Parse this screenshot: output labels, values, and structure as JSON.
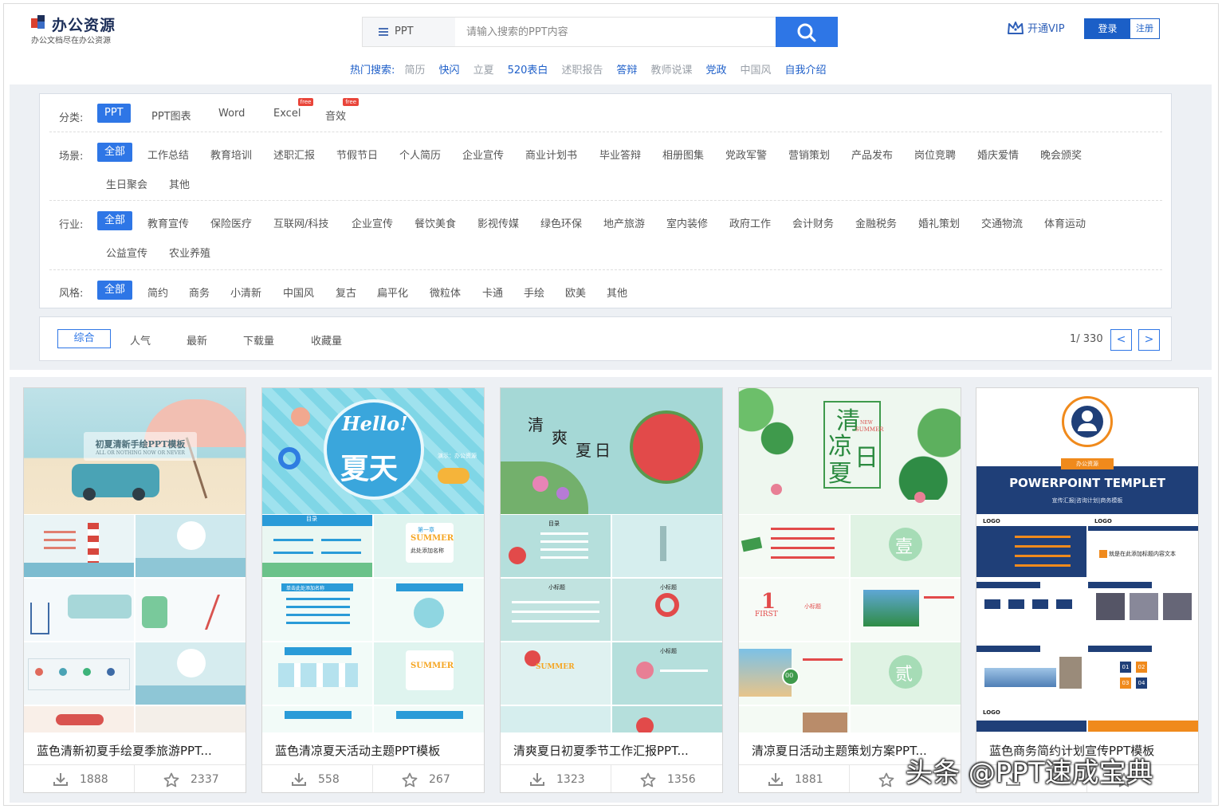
{
  "header": {
    "site_name": "办公资源",
    "slogan": "办公文档尽在办公资源",
    "search_category": "PPT",
    "search_placeholder": "请输入搜索的PPT内容",
    "hot_label": "热门搜索:",
    "hot_keywords": [
      {
        "text": "简历",
        "color": "#9aa0a8"
      },
      {
        "text": "快闪",
        "color": "#1e5fc9"
      },
      {
        "text": "立夏",
        "color": "#9aa0a8"
      },
      {
        "text": "520表白",
        "color": "#1e5fc9"
      },
      {
        "text": "述职报告",
        "color": "#9aa0a8"
      },
      {
        "text": "答辩",
        "color": "#1e5fc9"
      },
      {
        "text": "教师说课",
        "color": "#9aa0a8"
      },
      {
        "text": "党政",
        "color": "#1e5fc9"
      },
      {
        "text": "中国风",
        "color": "#9aa0a8"
      },
      {
        "text": "自我介绍",
        "color": "#1e5fc9"
      }
    ],
    "vip_label": "开通VIP",
    "login_label": "登录",
    "register_label": "注册"
  },
  "filters": {
    "category": {
      "label": "分类:",
      "options": [
        "PPT",
        "PPT图表",
        "Word",
        "Excel",
        "音效"
      ],
      "selected": 0,
      "free_badge": "free"
    },
    "scene": {
      "label": "场景:",
      "row1": [
        "全部",
        "工作总结",
        "教育培训",
        "述职汇报",
        "节假节日",
        "个人简历",
        "企业宣传",
        "商业计划书",
        "毕业答辩",
        "相册图集",
        "党政军警",
        "营销策划",
        "产品发布",
        "岗位竞聘",
        "婚庆爱情",
        "晚会颁奖"
      ],
      "row2": [
        "生日聚会",
        "其他"
      ]
    },
    "industry": {
      "label": "行业:",
      "row1": [
        "全部",
        "教育宣传",
        "保险医疗",
        "互联网/科技",
        "企业宣传",
        "餐饮美食",
        "影视传媒",
        "绿色环保",
        "地产旅游",
        "室内装修",
        "政府工作",
        "会计财务",
        "金融税务",
        "婚礼策划",
        "交通物流",
        "体育运动"
      ],
      "row2": [
        "公益宣传",
        "农业养殖"
      ]
    },
    "style": {
      "label": "风格:",
      "options": [
        "全部",
        "简约",
        "商务",
        "小清新",
        "中国风",
        "复古",
        "扁平化",
        "微粒体",
        "卡通",
        "手绘",
        "欧美",
        "其他"
      ]
    }
  },
  "sort": {
    "options": [
      "综合",
      "人气",
      "最新",
      "下载量",
      "收藏量"
    ],
    "page": "1/ 330",
    "prev": "<",
    "next": ">"
  },
  "cards": [
    {
      "title": "蓝色清新初夏手绘夏季旅游PPT...",
      "downloads": "1888",
      "favorites": "2337",
      "cover_title": "初夏清新手绘PPT模板",
      "cover_sub": "ALL OR NOTHING NOW OR NEVER"
    },
    {
      "title": "蓝色清凉夏天活动主题PPT模板",
      "downloads": "558",
      "favorites": "267",
      "cover_hello": "Hello!",
      "cover_title": "夏天",
      "cover_sub": "演示：办公资源",
      "sub_label": "目录",
      "chapter": "第一章",
      "summer": "SUMMER",
      "chapter_note": "此处添加名称",
      "item_label": "单击此处添加名称"
    },
    {
      "title": "清爽夏日初夏季节工作汇报PPT...",
      "downloads": "1323",
      "favorites": "1356",
      "cover_title": [
        "清",
        "爽",
        "夏",
        "日"
      ],
      "sub_label": "目录",
      "small_title": "小标题",
      "summer": "SUMMER"
    },
    {
      "title": "清凉夏日活动主题策划方案PPT...",
      "downloads": "1881",
      "favorites": "",
      "cover_title": [
        "清",
        "凉",
        "夏",
        "日"
      ],
      "cover_new": "NEW",
      "cover_summer": "SUMMER",
      "section_one": "壹",
      "section_two": "贰",
      "first": "FIRST",
      "number": "1",
      "small_title": "小标题",
      "badge": "00"
    },
    {
      "title": "蓝色商务简约计划宣传PPT模板",
      "downloads": "",
      "favorites": "",
      "cover_brand": "办公资源",
      "cover_title": "POWERPOINT TEMPLET",
      "cover_sub": "宣传汇报|咨询计划|商务模板",
      "logo": "LOGO",
      "content_label": "就是在此添加标题内容文本",
      "nums": [
        "01",
        "02",
        "03",
        "04"
      ]
    }
  ],
  "watermark": "头条 @PPT速成宝典",
  "colors": {
    "accent": "#2e76e6",
    "brand": "#1d2f59",
    "free": "#e9453a"
  }
}
